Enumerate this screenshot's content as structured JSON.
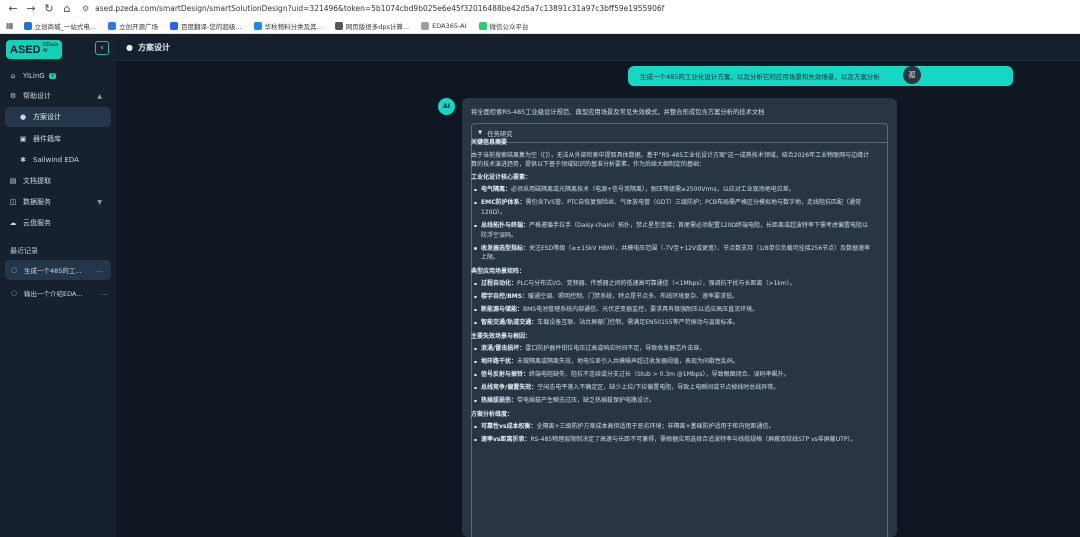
{
  "browser": {
    "url": "ased.pzeda.com/smartDesign/smartSolutionDesign?uid=321496&token=5b1074cbd9b025e6e45f32016488be42d5a7c13891c31a97c3bff59e1955906f",
    "bookmarks": [
      {
        "label": "立创商城_一站式电...",
        "color": "#1976d2"
      },
      {
        "label": "立创开源广场",
        "color": "#2a7ae2"
      },
      {
        "label": "百度翻译-您的超级...",
        "color": "#2563eb"
      },
      {
        "label": "华秋物料分类及其...",
        "color": "#1e88e5"
      },
      {
        "label": "网页版很多dps计算...",
        "color": "#555555"
      },
      {
        "label": "EDA365-AI",
        "color": "#9e9e9e"
      },
      {
        "label": "微信公众平台",
        "color": "#2ecc71"
      }
    ]
  },
  "sidebar": {
    "logo_main": "ASED",
    "logo_sub": "PZeda AI",
    "user": "YiLinG",
    "user_badge": "V",
    "nav": {
      "help_design": "帮助设计",
      "solution_design": "方案设计",
      "component_lib": "器件籍库",
      "sailwind": "Sailwind EDA",
      "doc_extract": "文档提取",
      "data_service": "数据服务",
      "cloud_service": "云盘服务"
    },
    "recent_label": "最近记录",
    "history": [
      {
        "label": "生成一个485的工..."
      },
      {
        "label": "输出一个介绍EDA..."
      }
    ]
  },
  "main": {
    "header_title": "方案设计",
    "user_message": "生成一个485的工业化设计方案，以及分析它的应用场景和失效场景，以及方案分析",
    "user_avatar": "孤",
    "ai_avatar": "AI",
    "ai_intro": "将全面检索RS-485工业级设计规范、典型应用场景及常见失效模式，并整合形成包含方案分析的技术文档",
    "task_title": "任务研究",
    "summary_title": "关键信息摘要",
    "summary_text": "由于当前搜索结果集为空（[]），无法从外部检索中提取具体数据。基于\"RS-485工业化设计方案\"这一成熟技术领域，结合2026年工业物联网与边缘计算的技术演进趋势，提供以下基于领域知识的基准分析要素，作为后续大纲制定的基础：",
    "sections": [
      {
        "title": "工业化设计核心要素：",
        "items": [
          {
            "b": "电气隔离：",
            "t": "必须采用磁隔离或光隔离技术（电源+信号双隔离），耐压等级需≥2500Vrms，以应对工业现场地电位差。"
          },
          {
            "b": "EMC防护体系：",
            "t": "需包含TVS管、PTC自恢复保险丝、气体放电管（GDT）三级防护；PCB布局需严格区分模拟地与数字地，走线阻抗匹配（通常120Ω）。"
          },
          {
            "b": "总线拓扑与终端：",
            "t": "严格遵循手拉手（Daisy-chain）拓扑，禁止星型连接；首尾需必须配置120Ω终端电阻，长距离或超波特率下需考虑偏置电阻以防浮空误码。"
          },
          {
            "b": "收发器选型指标：",
            "t": "关注ESD等级（≥±15kV HBM）、共模电压范围（-7V至+12V或更宽）、节点数支持（1/8单位负载可挂接256节点）及数据速率上限。"
          }
        ]
      },
      {
        "title": "典型应用场景矩阵：",
        "items": [
          {
            "b": "过程自动化：",
            "t": "PLC与分布式I/O、变频器、传感器之间的低速高可靠通信（<1Mbps），强调抗干扰与长距离（>1km）。"
          },
          {
            "b": "楼宇自控/BMS：",
            "t": "暖通空调、照明控制、门禁系统，特点是节点多、布线环境复杂、速率要求低。"
          },
          {
            "b": "新能源与储能：",
            "t": "BMS电池管理系统内部通信、光伏逆变器监控，要求具有极强耐压以适应高压直流环境。"
          },
          {
            "b": "智能交通/轨道交通：",
            "t": "车载设备互联、站台屏蔽门控制，需满足EN50155等严苛振动与温度标准。"
          }
        ]
      },
      {
        "title": "主要失效场景与根因：",
        "items": [
          {
            "b": "浪涌/雷击损坏：",
            "t": "雷口防护器件钳位电压过高或响应时间不足，导致收发器芯片击穿。"
          },
          {
            "b": "地环路干扰：",
            "t": "未做隔离或隔离失效，地电位差引入共模噪声超过收发器阈值，表现为间歇性乱码。"
          },
          {
            "b": "信号反射与振铃：",
            "t": "终端电阻缺失、阻抗不连续或分支过长（Stub > 0.3m @1Mbps），导致眼图闭合、误码率飙升。"
          },
          {
            "b": "总线竞争/偏置失效：",
            "t": "空闲态电平落入不确定区，缺少上拉/下拉偏置电阻，导致上电瞬间或节点掉线时总线异常。"
          },
          {
            "b": "热插拔损伤：",
            "t": "带电插拔产生瞬态过压，缺乏热插拔保护电路设计。"
          }
        ]
      },
      {
        "title": "方案分析维度：",
        "items": [
          {
            "b": "可靠性vs成本权衡：",
            "t": "全隔离+三级防护方案成本高但适用于恶劣环境；非隔离+基础防护适用于柜内短距通信。"
          },
          {
            "b": "速率vs距离折衷：",
            "t": "RS-485物理层限制决定了高速与长距不可兼得，需根据应用选择合适波特率与线缆规格（屏蔽双绞线STP vs非屏蔽UTP）。"
          }
        ]
      }
    ]
  }
}
